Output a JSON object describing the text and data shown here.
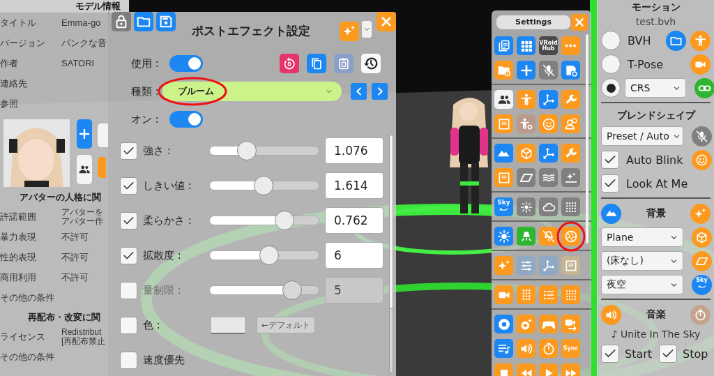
{
  "model_panel": {
    "title": "モデル情報",
    "info_rows": [
      {
        "label": "タイトル",
        "value": "Emma-go"
      },
      {
        "label": "バージョン",
        "value": "パンクな音"
      },
      {
        "label": "作者",
        "value": "SATORI"
      },
      {
        "label": "連絡先"
      },
      {
        "label": "参照"
      }
    ],
    "section_1": "アバターの人格に関",
    "permission_rows": [
      {
        "label": "許諾範囲",
        "value_lines": [
          "アバターを",
          "アバター作"
        ]
      },
      {
        "label": "暴力表現",
        "value": "不許可"
      },
      {
        "label": "性的表現",
        "value": "不許可"
      },
      {
        "label": "商用利用",
        "value": "不許可"
      },
      {
        "label": "その他の条件"
      }
    ],
    "section_2": "再配布・改変に関",
    "license_rows": [
      {
        "label": "ライセンス",
        "value_lines": [
          "Redistribut",
          "[再配布禁止"
        ]
      },
      {
        "label": "その他の条件"
      }
    ]
  },
  "effect_dialog": {
    "title": "ポストエフェクト設定",
    "use": {
      "label": "使用 :",
      "on": true
    },
    "type": {
      "label": "種類 :",
      "value": "ブルーム",
      "circled": true
    },
    "enabled": {
      "label": "オン :",
      "on": true
    },
    "params": [
      {
        "label": "強さ :",
        "checked": true,
        "level": 0.31,
        "value": "1.076",
        "disabled": false
      },
      {
        "label": "しきい値 :",
        "checked": true,
        "level": 0.49,
        "value": "1.614",
        "disabled": false
      },
      {
        "label": "柔らかさ :",
        "checked": true,
        "level": 0.72,
        "value": "0.762",
        "disabled": false
      },
      {
        "label": "拡散度 :",
        "checked": true,
        "level": 0.55,
        "value": "6",
        "disabled": false
      },
      {
        "label": "量制限 :",
        "checked": false,
        "level": 0.81,
        "value": "5",
        "disabled": true
      }
    ],
    "color": {
      "label": "色 :",
      "checked": false,
      "default_button": "←デフォルト"
    },
    "speed_priority": {
      "label": "速度優先",
      "checked": false
    }
  },
  "settings_panel": {
    "title": "Settings",
    "groups": [
      [
        [
          {
            "color": "#1c86f2",
            "circled": false
          },
          {
            "color": "#1c86f2",
            "circled": false
          },
          {
            "color": "#4a4a4a",
            "label": "VRoid Hub",
            "circled": false
          },
          {
            "color": "#fb9a1e",
            "circled": false
          }
        ],
        [
          {
            "color": "#fb9a1e",
            "circled": false
          },
          {
            "color": "#1c86f2",
            "circled": false
          },
          {
            "color": "#808080",
            "circled": false
          },
          {
            "color": "#1c86f2",
            "circled": false
          }
        ]
      ],
      [
        [
          {
            "color": "#f4f4f4",
            "circled": false
          },
          {
            "color": "#fb9a1e",
            "circled": false
          },
          {
            "color": "#1c86f2",
            "circled": false
          },
          {
            "color": "#fb9a1e",
            "circled": false
          }
        ],
        [
          {
            "color": "#fb9a1e",
            "circled": false
          },
          {
            "color": "#b8998a",
            "circled": false
          },
          {
            "color": "#fb9a1e",
            "circled": false
          },
          {
            "color": "#fb9a1e",
            "circled": false
          }
        ]
      ],
      [
        [
          {
            "color": "#1c86f2",
            "circled": false
          },
          {
            "color": "#fb9a1e",
            "circled": false
          },
          {
            "color": "#1c86f2",
            "circled": false
          },
          {
            "color": "#fb9a1e",
            "circled": false
          }
        ],
        [
          {
            "color": "#fb9a1e",
            "circled": false
          },
          {
            "color": "#808080",
            "circled": false
          },
          {
            "color": "#808080",
            "circled": false
          },
          {
            "color": "#808080",
            "circled": false
          }
        ]
      ],
      [
        [
          {
            "color": "#1c86f2",
            "label": "Sky",
            "circled": false
          },
          {
            "color": "#808080",
            "circled": false
          },
          {
            "color": "#808080",
            "circled": false
          },
          {
            "color": "#808080",
            "circled": false
          }
        ]
      ],
      [
        [
          {
            "color": "#1c86f2",
            "circled": false
          },
          {
            "color": "#2fb52f",
            "circled": false
          },
          {
            "color": "#fb9a1e",
            "circled": false
          },
          {
            "color": "#fb9a1e",
            "circled": true
          }
        ]
      ],
      [
        [
          {
            "color": "#fb9a1e",
            "circled": false
          },
          {
            "color": "#8fa8c4",
            "circled": false
          },
          {
            "color": "#8fa8c4",
            "circled": false
          },
          {
            "color": "#c4b494",
            "circled": false
          }
        ]
      ],
      [
        [
          {
            "color": "#fb9a1e",
            "circled": false
          },
          {
            "color": "#fb9a1e",
            "circled": false
          },
          {
            "color": "#fb9a1e",
            "circled": false
          },
          {
            "color": "#fb9a1e",
            "circled": false
          }
        ]
      ],
      [
        [
          {
            "color": "#1c86f2",
            "circled": false
          },
          {
            "color": "#fb9a1e",
            "circled": false
          },
          {
            "color": "#fb9a1e",
            "circled": false
          },
          {
            "color": "#fb9a1e",
            "circled": false
          }
        ],
        [
          {
            "color": "#1c86f2",
            "circled": false
          },
          {
            "color": "#fb9a1e",
            "circled": false
          },
          {
            "color": "#fb9a1e",
            "circled": false
          },
          {
            "color": "#fb9a1e",
            "label": "Sync",
            "circled": false
          }
        ],
        [
          {
            "color": "#fb9a1e",
            "circled": false
          },
          {
            "color": "#fb9a1e",
            "circled": false
          },
          {
            "color": "#fb9a1e",
            "circled": false
          },
          {
            "color": "#fb9a1e",
            "circled": false
          }
        ]
      ]
    ]
  },
  "motion_panel": {
    "title": "モーション",
    "file": "test.bvh",
    "modes": [
      {
        "label": "BVH",
        "selected": false
      },
      {
        "label": "T-Pose",
        "selected": false
      },
      {
        "dropdown": "CRS",
        "selected": true
      }
    ],
    "blendshape_title": "ブレンドシェイプ",
    "blendshape_preset": "Preset / Auto",
    "toggles": [
      {
        "label": "Auto Blink",
        "checked": true
      },
      {
        "label": "Look At Me",
        "checked": true
      }
    ],
    "background_title": "背景",
    "background_selects": [
      "Plane",
      "(床なし)",
      "夜空"
    ],
    "sky_label": "Sky",
    "music_title": "音楽",
    "track": "♪ Unite In The Sky",
    "playback": [
      {
        "label": "Start",
        "checked": true
      },
      {
        "label": "Stop",
        "checked": true
      }
    ]
  }
}
